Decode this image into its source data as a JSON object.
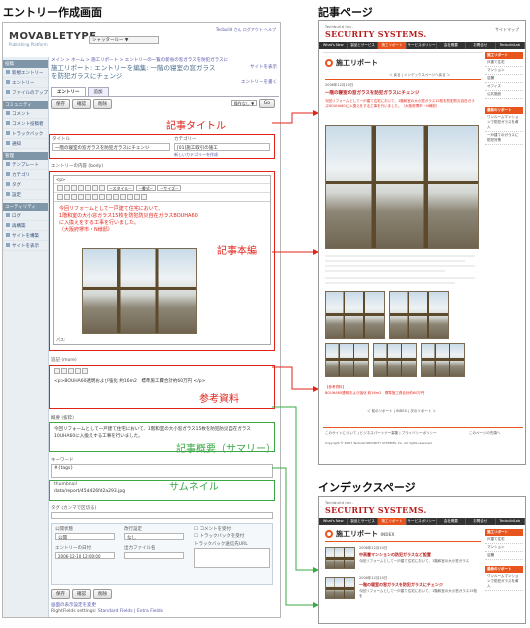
{
  "headings": {
    "editor": "エントリー作成画面",
    "article": "記事ページ",
    "index": "インデックスページ"
  },
  "mt": {
    "logo": "MOVABLETYPE",
    "logo_sub": "Publishing Platform",
    "blog_select": "シャッタールー ▼",
    "top_links": "Tecbuild さん  ログアウト  ヘルプ",
    "breadcrumb": "メイン > ホーム > 施工リポート > エントリーの一覧の新省の窓ガラスを防犯ガラスに",
    "page_title": "施工リポート: エントリーを編集: 一階の寝室の窓ガラスを防犯ガラスにチェンジ",
    "view_link": "サイトを表示",
    "new_entry_link": "エントリーを書く",
    "sidebar_sections": [
      {
        "title": "投稿",
        "items": [
          "新規エントリー",
          "エントリー",
          "ファイルのアップロード"
        ]
      },
      {
        "title": "コミュニティ",
        "items": [
          "コメント",
          "コメント投稿者",
          "トラックバック",
          "通知"
        ]
      },
      {
        "title": "管理",
        "items": [
          "テンプレート",
          "カテゴリ",
          "タグ",
          "設定"
        ]
      },
      {
        "title": "ユーティリティ",
        "items": [
          "ログ",
          "再構築",
          "サイトを構築",
          "サイトを表示"
        ]
      }
    ],
    "tabs": [
      "エントリー",
      "追加"
    ],
    "buttons": {
      "save": "保存",
      "preview": "確認",
      "delete": "削除",
      "action": "操作なし ▼",
      "go": "Go"
    },
    "title_label": "タイトル",
    "title_value": "一階の寝室の窓ガラスを防犯ガラスにチェンジ",
    "category_label": "カテゴリー",
    "category_value": "[01]施工取引の施工",
    "category_link": "新しいカテゴリーを作成",
    "body_label": "エントリーの内容 (body)",
    "editor_tag": "<p>",
    "format_select": "--スタイル--",
    "font_select": "--書式--",
    "size_select": "--サイズ--",
    "body_text": [
      "今回リフォームとして一戸建て住宅において、",
      "1階和室の大小窓ガラス15枚を防犯防災自在ガラスBOUHA60",
      "に入換えをする工事を行いました。",
      "（大阪府堺市・N様邸）"
    ],
    "editor_path": "パス:",
    "extended_label": "追記 (more)",
    "extended_text": "<p>BOUHA60透明および強化 約16m2　標準施工費合計約60万円 </p>",
    "excerpt_label": "概要 (抜粋)",
    "excerpt_text": "今回リフォームとして一戸建て住宅において、1階和室の大小窓ガラス15枚を防犯防災自在ガラス10UHA60に入換えする工事を行いました。",
    "keywords_label": "キーワード",
    "keywords_value": "#{tags}",
    "thumb_label": "thumbnail",
    "thumb_value": "data/report/45d426fd2a293.jpg",
    "tags_label": "タグ (カンマで区切る)",
    "status_label": "公開状態",
    "status_value": "公開",
    "format_label": "改行設定",
    "format_value": "なし",
    "comments_label": "コメントを受付",
    "tb_label": "トラックバックを受付",
    "date_label": "エントリーの日付",
    "date_value": "2006-12-10 12:00:00",
    "basename_label": "出力ファイル名",
    "basename_value": "",
    "tb_urls_label": "トラックバック送信先URL",
    "footer_link": "画面の表示設定を変更",
    "rf_label": "RightFields settings:",
    "rf_links": "Standard Fields | Extra Fields"
  },
  "annotations": {
    "title": "記事タイトル",
    "body": "記事本編",
    "extended": "参考資料",
    "excerpt": "記事概要（サマリー）",
    "thumbnail": "サムネイル"
  },
  "article": {
    "logo": "SECURITY SYSTEMS.",
    "logo_sub": "Techbuild Inc.",
    "nav": [
      "What's New",
      "製品とサービス",
      "施工リポート",
      "サービスポリシー",
      "会社概要",
      "お問合せ",
      "TecbuildLab"
    ],
    "title": "施工リポート",
    "subnav": "＜ 戻る  |  インデックスページへ戻る  ＞",
    "date": "2006年12月10日",
    "entry_title": "一階の寝室の窓ガラスを防犯ガラスにチェンジ",
    "lead": "今回リフォームとして一戸建て住宅において、1階和室の大小窓ガラス15枚を防犯防災自在ガラスBOUHA60に入換えをする工事を行いました。（大阪府堺市・N様邸）",
    "ref_title": "【参考資料】",
    "ref_text": "BOUHA60透明および強化 約16m2　標準施工費合計約60万円",
    "pager": "＜ 前のリポート  |  INDEX  |  次のリポート ＞",
    "footer_links": "このサイトについて | ビジネスパートナー募集 | プライバシーポリシー",
    "copyright": "Copyright © 2007 Tecbuild SECURITY SYSTEMS, Inc. All rights reserved.",
    "sidebar_head": "施工リポート",
    "sidebar_items": [
      "戸建て住宅",
      "マンション",
      "店舗",
      "オフィス",
      "公共施設"
    ],
    "sidebar_head2": "最新のリポート",
    "sidebar_news": [
      "ワンルームマンションで防犯ガラスを導入",
      "一戸建てのガラスに防犯対策"
    ],
    "search_label": "サイトマップ",
    "top_link": "このページの先頭へ"
  },
  "index": {
    "logo": "SECURITY SYSTEMS.",
    "logo_sub": "Techbuild Inc.",
    "nav": [
      "What's New",
      "製品とサービス",
      "施工リポート",
      "サービスポリシー",
      "会社概要",
      "お問合せ",
      "TecbuildLab"
    ],
    "title": "施工リポート",
    "title_suffix": "INDEX",
    "items": [
      {
        "date": "2006年12月10日",
        "title": "中高層マンションの防犯ガラスなど設置",
        "desc": "今回リフォームとして一戸建て住宅において、1階和室の大小窓ガラス"
      },
      {
        "date": "2006年12月10日",
        "title": "一階の寝室の窓ガラスを防犯ガラスにチェンジ",
        "desc": "今回リフォームとして一戸建て住宅において、1階和室の大小窓ガラス15枚を"
      }
    ],
    "sidebar_head": "施工リポート",
    "sidebar_items": [
      "戸建て住宅",
      "マンション",
      "店舗"
    ],
    "sidebar_head2": "最新のリポート",
    "sidebar_news": [
      "ワンルームマンションで防犯ガラスを導入"
    ]
  },
  "colors": {
    "annotation_red": "#e2231a",
    "annotation_green": "#3aa845",
    "site_accent": "#e8541e",
    "brand_red": "#b71c1c"
  }
}
